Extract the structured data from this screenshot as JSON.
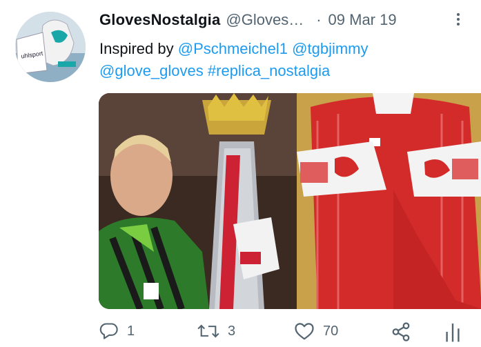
{
  "tweet": {
    "display_name": "GlovesNostalgia",
    "handle": "@Gloves…",
    "separator": "·",
    "date": "09 Mar 19",
    "more_icon": "more-vertical-icon",
    "text_prefix": "Inspired by ",
    "mentions": [
      "@Pschmeichel1",
      "@tgbjimmy",
      "@glove_gloves"
    ],
    "hashtag": "#replica_nostalgia"
  },
  "actions": {
    "reply": {
      "icon": "reply-icon",
      "count": "1"
    },
    "retweet": {
      "icon": "retweet-icon",
      "count": "3"
    },
    "like": {
      "icon": "heart-icon",
      "count": "70"
    },
    "share": {
      "icon": "share-icon"
    },
    "analytics": {
      "icon": "analytics-icon"
    }
  },
  "colors": {
    "link": "#1d9bf0",
    "secondary_text": "#536471",
    "primary_text": "#0f1419"
  }
}
